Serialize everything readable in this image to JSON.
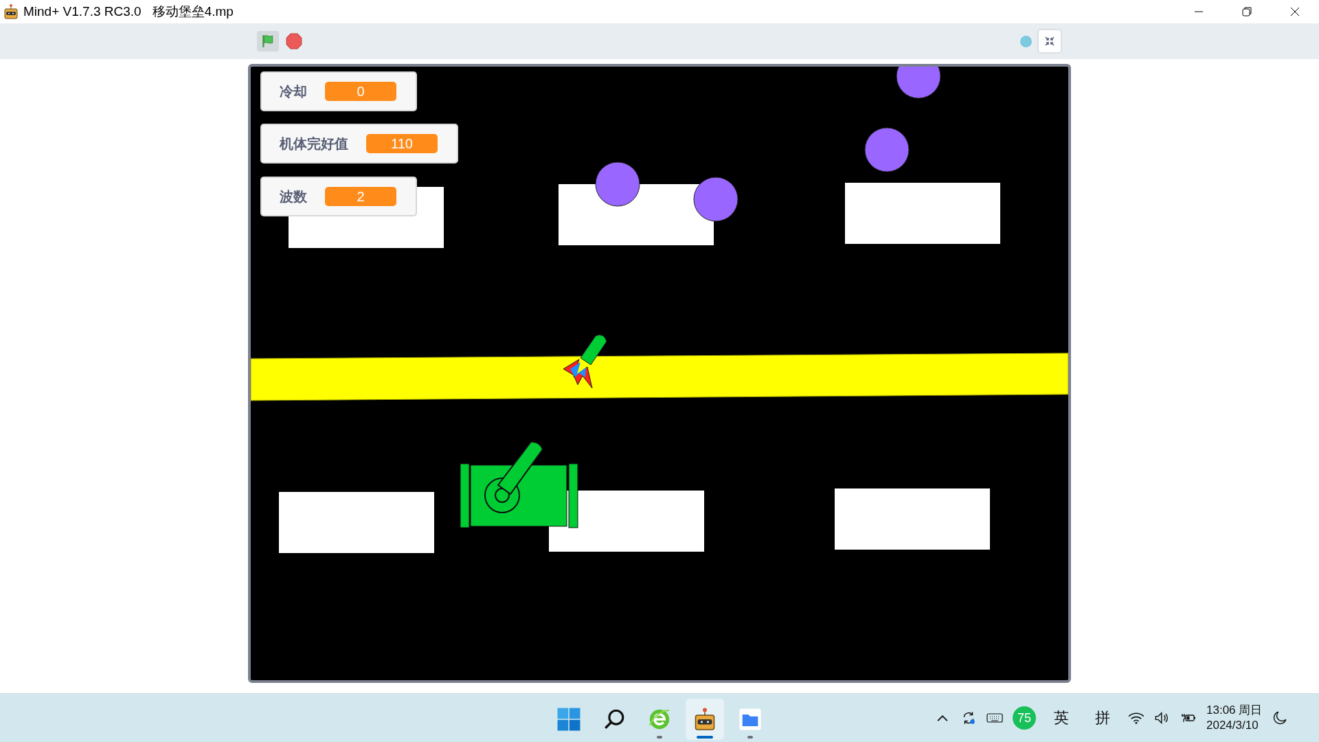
{
  "window": {
    "app_title": "Mind+ V1.7.3 RC3.0",
    "file_name": "移动堡垒4.mp"
  },
  "monitors": [
    {
      "label": "冷却",
      "value": "0"
    },
    {
      "label": "机体完好值",
      "value": "110"
    },
    {
      "label": "波数",
      "value": "2"
    }
  ],
  "taskbar": {
    "apps": [
      {
        "kind": "start",
        "selected": false,
        "running": false
      },
      {
        "kind": "search",
        "selected": false,
        "running": false
      },
      {
        "kind": "browser",
        "selected": false,
        "running": true
      },
      {
        "kind": "robot",
        "selected": true,
        "running": true
      },
      {
        "kind": "folder",
        "selected": false,
        "running": true
      }
    ],
    "tray": {
      "badge": "75",
      "ime_lang": "英",
      "ime_mode": "拼",
      "time": "13:06 周日",
      "date": "2024/3/10"
    }
  }
}
